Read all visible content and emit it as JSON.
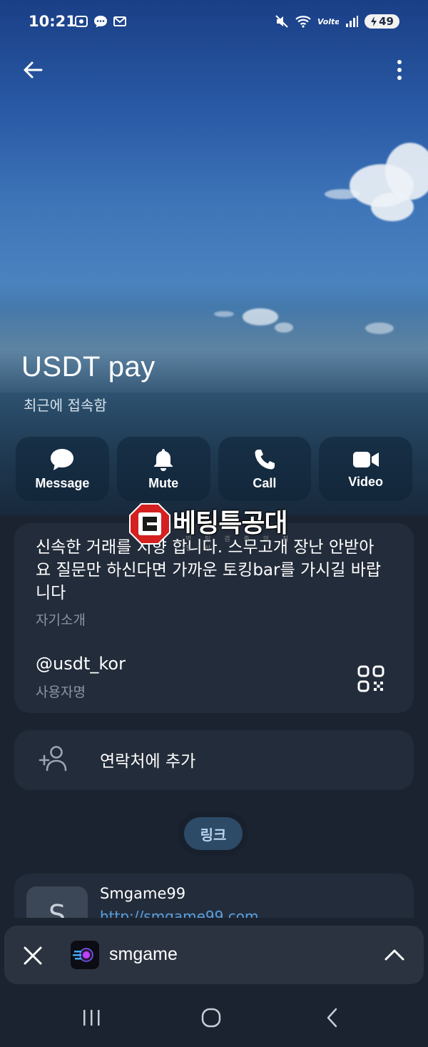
{
  "status_bar": {
    "time": "10:21",
    "battery": "49"
  },
  "profile": {
    "name": "USDT pay",
    "last_seen": "최근에 접속함"
  },
  "actions": [
    {
      "label": "Message",
      "icon": "chat-bubble-icon"
    },
    {
      "label": "Mute",
      "icon": "bell-icon"
    },
    {
      "label": "Call",
      "icon": "phone-icon"
    },
    {
      "label": "Video",
      "icon": "video-camera-icon"
    }
  ],
  "bio": {
    "text": "신속한 거래를 지향 합니다. 스무고개 장난 안받아요 질문만 하신다면 가까운 토킹bar를 가시길 바랍니다",
    "caption": "자기소개"
  },
  "username": {
    "value": "@usdt_kor",
    "caption": "사용자명"
  },
  "add_contact": {
    "label": "연락처에 추가"
  },
  "links_tab": {
    "label": "링크"
  },
  "link_item": {
    "avatar_letter": "S",
    "title": "Smgame99",
    "url": "http://smgame99.com"
  },
  "miniplayer": {
    "title": "smgame"
  },
  "watermark": {
    "text": "베팅특공대",
    "subtext": "먹 튀 검 증 의 최 정 상"
  },
  "colors": {
    "background": "#1b2330",
    "card": "#232c3a",
    "accent_link": "#5aa0e0",
    "chip": "#2d4a66"
  }
}
